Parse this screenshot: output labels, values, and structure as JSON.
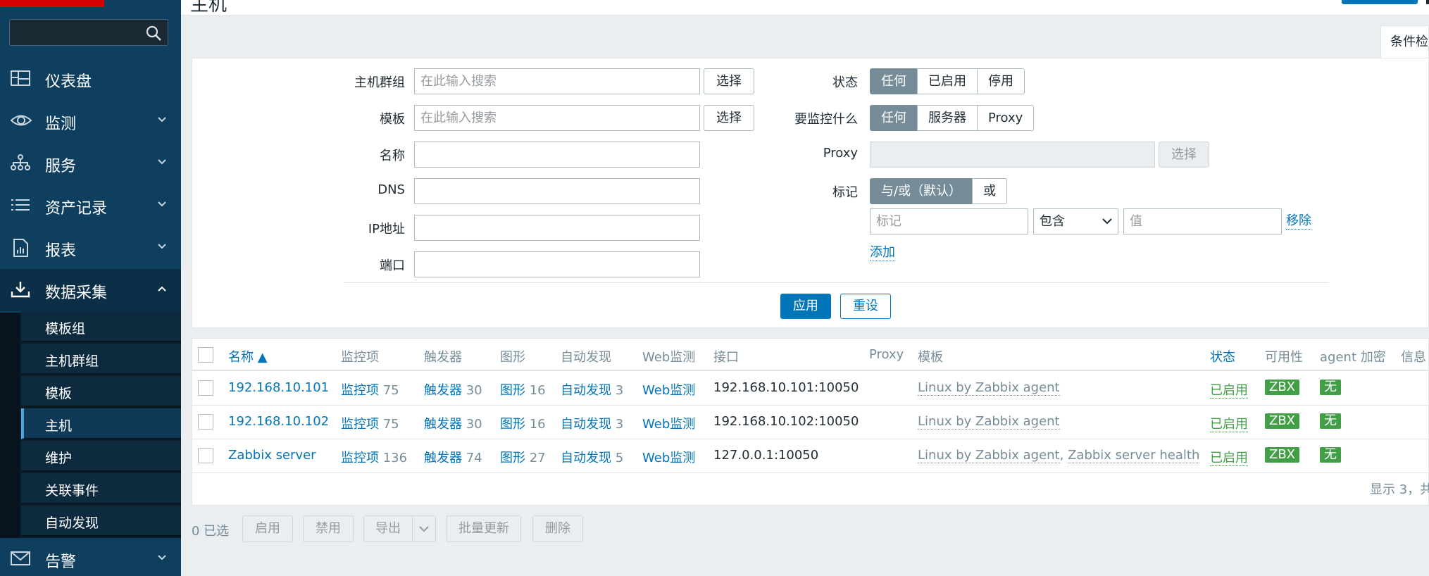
{
  "header": {
    "title": "主机"
  },
  "sidebar": {
    "search_placeholder": "",
    "items": [
      {
        "label": "仪表盘"
      },
      {
        "label": "监测"
      },
      {
        "label": "服务"
      },
      {
        "label": "资产记录"
      },
      {
        "label": "报表"
      },
      {
        "label": "数据采集"
      },
      {
        "label": "告警"
      }
    ],
    "submenu": [
      "模板组",
      "主机群组",
      "模板",
      "主机",
      "维护",
      "关联事件",
      "自动发现"
    ],
    "selected_submenu": "主机"
  },
  "filter_tab": "条件检",
  "filter": {
    "host_group_label": "主机群组",
    "template_label": "模板",
    "name_label": "名称",
    "dns_label": "DNS",
    "ip_label": "IP地址",
    "port_label": "端口",
    "search_placeholder": "在此输入搜索",
    "select_button": "选择",
    "status_label": "状态",
    "status_options": [
      "任何",
      "已启用",
      "停用"
    ],
    "monitored_by_label": "要监控什么",
    "monitored_by_options": [
      "任何",
      "服务器",
      "Proxy"
    ],
    "proxy_label": "Proxy",
    "tags_label": "标记",
    "tags_options": [
      "与/或（默认）",
      "或"
    ],
    "tag_placeholder": "标记",
    "tag_operator": "包含",
    "value_placeholder": "值",
    "remove_link": "移除",
    "add_link": "添加",
    "apply_button": "应用",
    "reset_button": "重设"
  },
  "table": {
    "columns": [
      "名称 ▲",
      "监控项",
      "触发器",
      "图形",
      "自动发现",
      "Web监测",
      "接口",
      "Proxy",
      "模板",
      "状态",
      "可用性",
      "agent 加密",
      "信息"
    ],
    "rows": [
      {
        "name": "192.168.10.101",
        "items": "监控项",
        "items_count": "75",
        "triggers": "触发器",
        "triggers_count": "30",
        "graphs": "图形",
        "graphs_count": "16",
        "discovery": "自动发现",
        "discovery_count": "3",
        "web": "Web监测",
        "interface": "192.168.10.101:10050",
        "templates": [
          "Linux by Zabbix agent"
        ],
        "status": "已启用",
        "availability": "ZBX",
        "encryption": "无"
      },
      {
        "name": "192.168.10.102",
        "items": "监控项",
        "items_count": "75",
        "triggers": "触发器",
        "triggers_count": "30",
        "graphs": "图形",
        "graphs_count": "16",
        "discovery": "自动发现",
        "discovery_count": "3",
        "web": "Web监测",
        "interface": "192.168.10.102:10050",
        "templates": [
          "Linux by Zabbix agent"
        ],
        "status": "已启用",
        "availability": "ZBX",
        "encryption": "无"
      },
      {
        "name": "Zabbix server",
        "items": "监控项",
        "items_count": "136",
        "triggers": "触发器",
        "triggers_count": "74",
        "graphs": "图形",
        "graphs_count": "27",
        "discovery": "自动发现",
        "discovery_count": "5",
        "web": "Web监测",
        "interface": "127.0.0.1:10050",
        "templates": [
          "Linux by Zabbix agent",
          "Zabbix server health"
        ],
        "template_sep": ",",
        "status": "已启用",
        "availability": "ZBX",
        "encryption": "无"
      }
    ],
    "footer": "显示 3，共"
  },
  "actions": {
    "selected": "0 已选",
    "enable": "启用",
    "disable": "禁用",
    "export": "导出",
    "mass_update": "批量更新",
    "delete": "删除"
  },
  "colors": {
    "primary": "#0275b8",
    "sidebar": "#0e3f5e",
    "enabled": "#429e47"
  }
}
